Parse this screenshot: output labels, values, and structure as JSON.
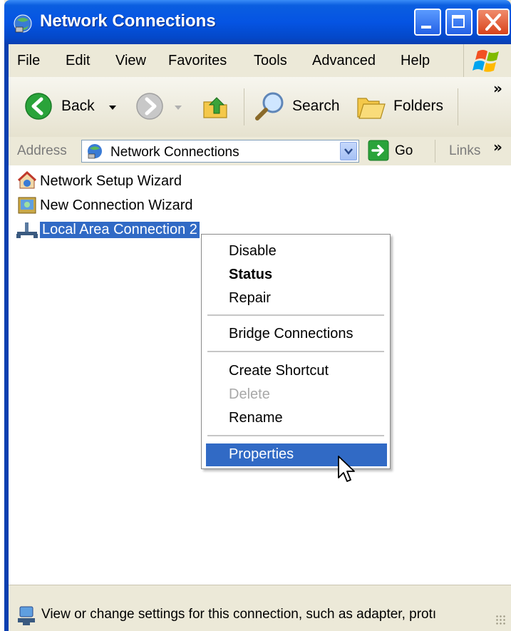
{
  "window": {
    "title": "Network Connections"
  },
  "menubar": {
    "items": [
      "File",
      "Edit",
      "View",
      "Favorites",
      "Tools",
      "Advanced",
      "Help"
    ]
  },
  "toolbar": {
    "back_label": "Back",
    "search_label": "Search",
    "folders_label": "Folders",
    "overflow": "»"
  },
  "addressbar": {
    "label": "Address",
    "value": "Network Connections",
    "go_label": "Go",
    "links_label": "Links",
    "overflow": "»"
  },
  "content": {
    "items": [
      {
        "label": "Network Setup Wizard",
        "icon": "network-setup-wizard-icon"
      },
      {
        "label": "New Connection Wizard",
        "icon": "new-connection-wizard-icon"
      },
      {
        "label": "Local Area Connection 2",
        "icon": "local-area-connection-icon",
        "selected": true
      }
    ]
  },
  "context_menu": {
    "items": [
      {
        "label": "Disable"
      },
      {
        "label": "Status",
        "bold": true
      },
      {
        "label": "Repair"
      },
      {
        "label": "Bridge Connections"
      },
      {
        "label": "Create Shortcut"
      },
      {
        "label": "Delete",
        "disabled": true
      },
      {
        "label": "Rename"
      },
      {
        "label": "Properties",
        "highlighted": true
      }
    ]
  },
  "statusbar": {
    "text": "View or change settings for this connection, such as adapter, protı"
  },
  "colors": {
    "titlebar": "#0554e3",
    "selection": "#316ac5",
    "close_button": "#d8431b",
    "go_arrow": "#2aa33a"
  }
}
